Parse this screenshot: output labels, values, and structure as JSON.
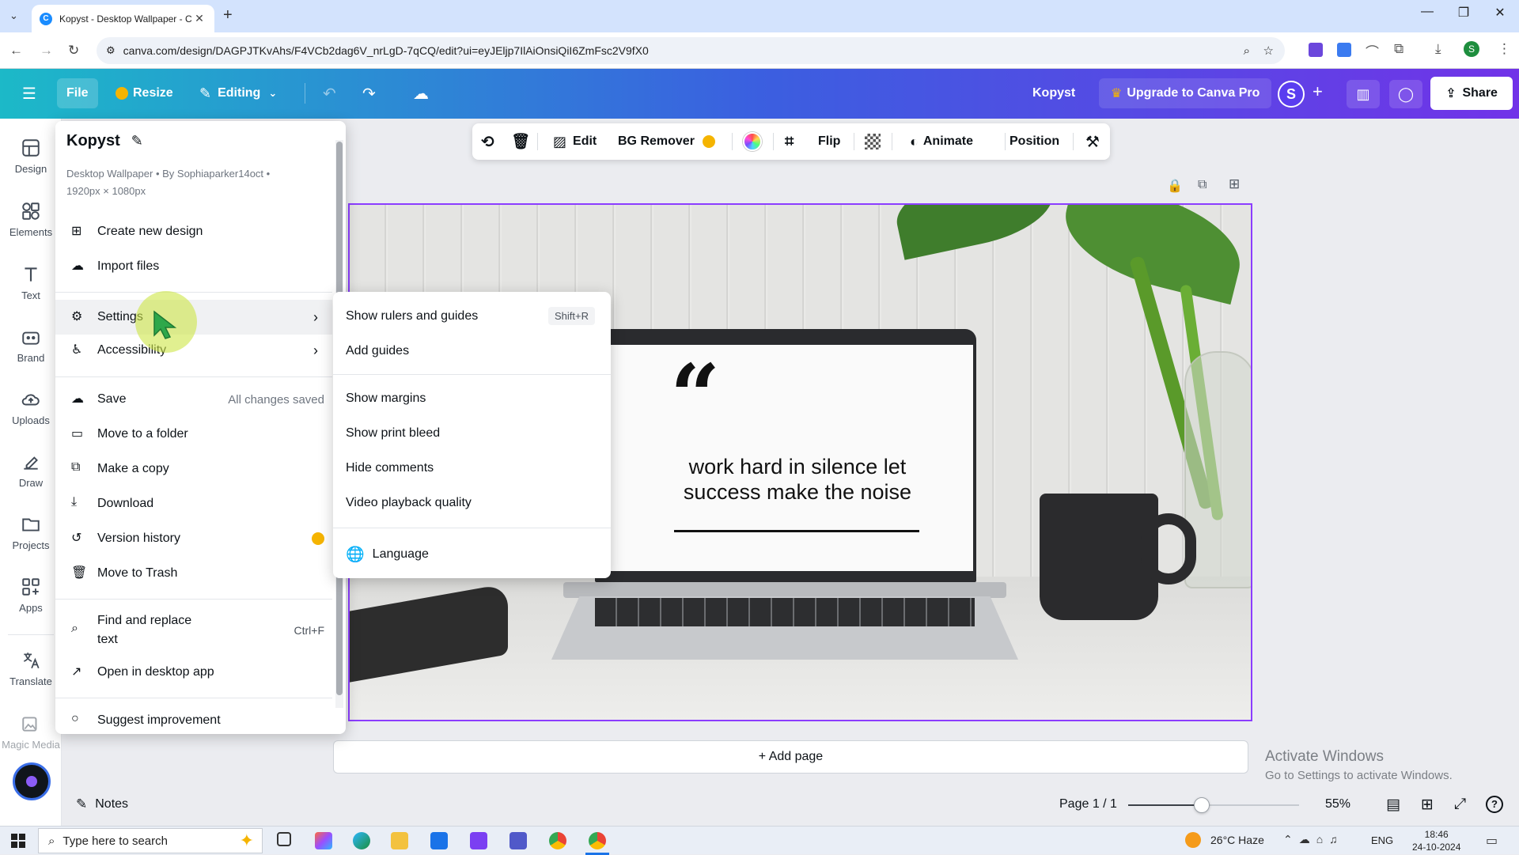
{
  "browser": {
    "tab_title": "Kopyst - Desktop Wallpaper - C",
    "url": "canva.com/design/DAGPJTKvAhs/F4VCb2dag6V_nrLgD-7qCQ/edit?ui=eyJEljp7IlAiOnsiQiI6ZmFsc2V9fX0"
  },
  "header": {
    "file_label": "File",
    "resize_label": "Resize",
    "editing_label": "Editing",
    "design_name": "Kopyst",
    "upgrade_label": "Upgrade to Canva Pro",
    "avatar_letter": "S",
    "share_label": "Share"
  },
  "rail": {
    "items": [
      {
        "label": "Design",
        "icon": "layout-icon"
      },
      {
        "label": "Elements",
        "icon": "shapes-icon"
      },
      {
        "label": "Text",
        "icon": "text-icon"
      },
      {
        "label": "Brand",
        "icon": "brand-icon"
      },
      {
        "label": "Uploads",
        "icon": "cloud-upload-icon"
      },
      {
        "label": "Draw",
        "icon": "pen-icon"
      },
      {
        "label": "Projects",
        "icon": "folder-icon"
      },
      {
        "label": "Apps",
        "icon": "apps-icon"
      },
      {
        "label": "Translate",
        "icon": "translate-icon"
      },
      {
        "label": "Magic Media",
        "icon": "magic-media-icon"
      }
    ]
  },
  "toolbar": {
    "edit_label": "Edit",
    "bg_remover_label": "BG Remover",
    "flip_label": "Flip",
    "animate_label": "Animate",
    "position_label": "Position"
  },
  "file_menu": {
    "title": "Kopyst",
    "meta_line1": "Desktop Wallpaper • By Sophiaparker14oct •",
    "meta_line2": "1920px × 1080px",
    "items": {
      "create": "Create new design",
      "import": "Import files",
      "settings": "Settings",
      "accessibility": "Accessibility",
      "save": "Save",
      "save_status": "All changes saved",
      "move_folder": "Move to a folder",
      "copy": "Make a copy",
      "download": "Download",
      "version": "Version history",
      "trash": "Move to Trash",
      "find_line1": "Find and replace",
      "find_line2": "text",
      "find_shortcut": "Ctrl+F",
      "desktop": "Open in desktop app",
      "suggest": "Suggest improvement"
    }
  },
  "settings_submenu": {
    "rulers": "Show rulers and guides",
    "rulers_shortcut": "Shift+R",
    "add_guides": "Add guides",
    "margins": "Show margins",
    "print_bleed": "Show print bleed",
    "hide_comments": "Hide comments",
    "video_quality": "Video playback quality",
    "language": "Language"
  },
  "canvas": {
    "quote_mark": "“",
    "quote_line1": "work hard in silence let",
    "quote_line2": "success make the noise",
    "add_page": "+ Add page"
  },
  "watermark": {
    "line1": "Activate Windows",
    "line2": "Go to Settings to activate Windows."
  },
  "bottom": {
    "notes": "Notes",
    "page": "Page 1 / 1",
    "zoom": "55%",
    "zoom_fraction": 0.43
  },
  "taskbar": {
    "search_placeholder": "Type here to search",
    "weather": "26°C  Haze",
    "lang": "ENG",
    "time": "18:46",
    "date": "24-10-2024"
  },
  "colors": {
    "accent": "#8b3dff",
    "header_start": "#1cb9c8",
    "header_end": "#7133e8",
    "highlight": "#cde646"
  }
}
